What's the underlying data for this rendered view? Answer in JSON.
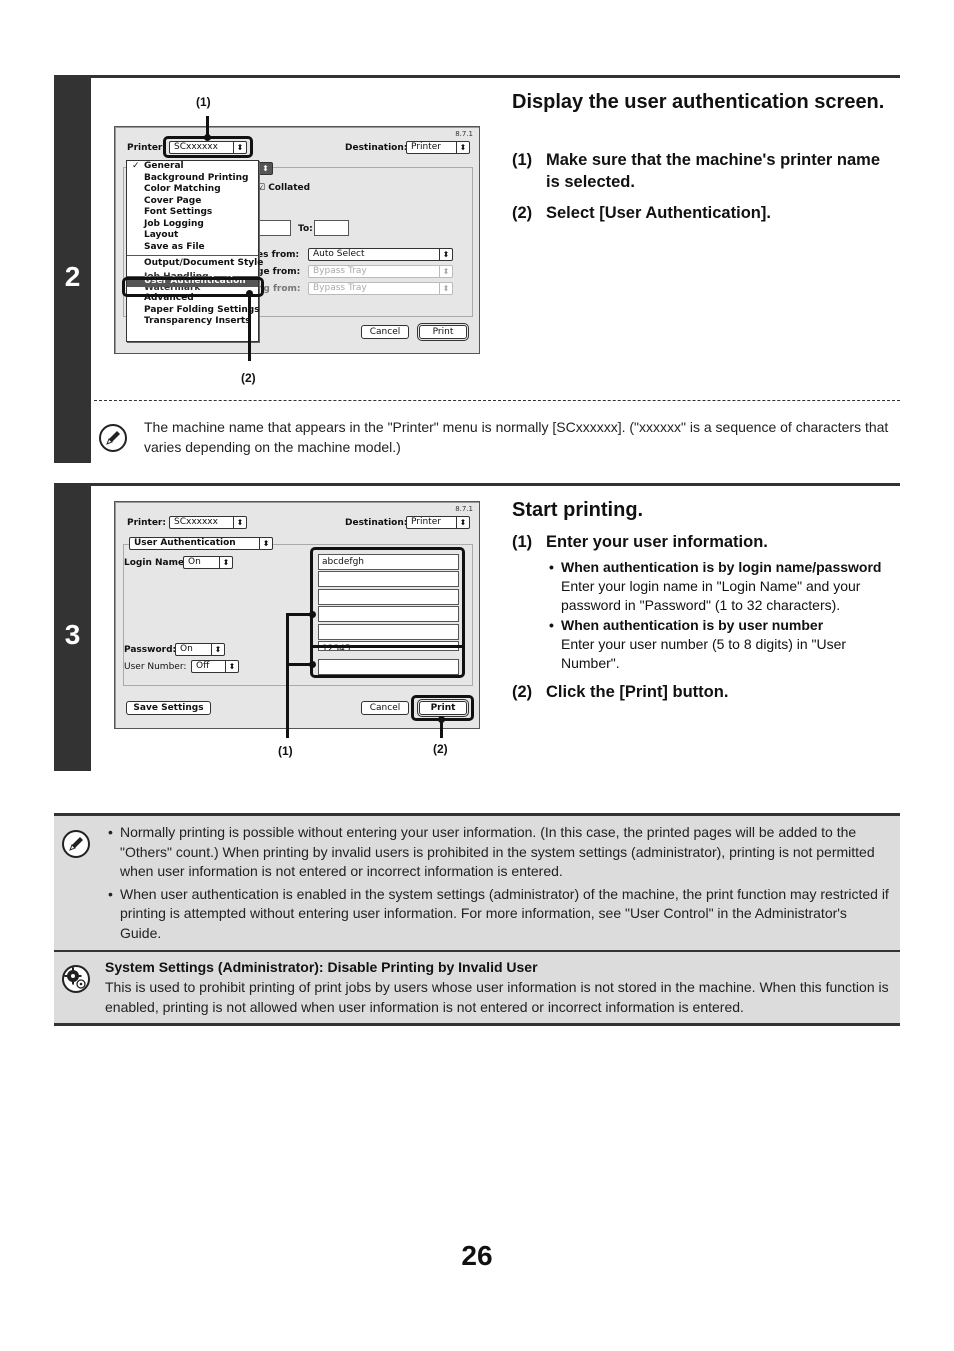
{
  "step2": {
    "number": "2",
    "heading": "Display the user authentication screen.",
    "items": [
      {
        "num": "(1)",
        "text": "Make sure that the machine's printer name is selected."
      },
      {
        "num": "(2)",
        "text": "Select [User Authentication]."
      }
    ],
    "dialog": {
      "version": "8.7.1",
      "printer_label": "Printer:",
      "printer_value": "SCxxxxxx",
      "destination_label": "Destination:",
      "destination_value": "Printer",
      "menu_items": [
        "General",
        "Background Printing",
        "Color Matching",
        "Cover Page",
        "Font Settings",
        "Job Logging",
        "Layout",
        "Save as File",
        "Output/Document Style",
        "Job Handling",
        "User Authentication",
        "Watermark",
        "Advanced",
        "Paper Folding Settings",
        "Transparency Inserts"
      ],
      "checked_item": "General",
      "selected_item": "User Authentication",
      "collated_label": "Collated",
      "to_label": "To:",
      "pages_from_label": "es from:",
      "pages_from_value": "Auto Select",
      "first_page_label": "ge from:",
      "first_page_value": "Bypass Tray",
      "remaining_label": "ng from:",
      "remaining_value": "Bypass Tray",
      "cancel_label": "Cancel",
      "print_label": "Print",
      "callout_1": "(1)",
      "callout_2": "(2)"
    },
    "note": "The machine name that appears in the \"Printer\" menu is normally [SCxxxxxx]. (\"xxxxxx\" is a sequence of characters that varies depending on the machine model.)"
  },
  "step3": {
    "number": "3",
    "heading": "Start printing.",
    "item1": {
      "num": "(1)",
      "text": "Enter your user information."
    },
    "bullets": [
      {
        "title": "When authentication is by login name/password",
        "text": "Enter your login name in \"Login Name\" and your password in \"Password\" (1 to 32 characters)."
      },
      {
        "title": "When authentication is by user number",
        "text": "Enter your user number (5 to 8 digits) in \"User Number\"."
      }
    ],
    "item2": {
      "num": "(2)",
      "text": "Click the [Print] button."
    },
    "dialog": {
      "version": "8.7.1",
      "printer_label": "Printer:",
      "printer_value": "SCxxxxxx",
      "destination_label": "Destination:",
      "destination_value": "Printer",
      "panel_value": "User Authentication",
      "login_name_label": "Login Name:",
      "login_name_value": "On",
      "password_label": "Password:",
      "password_value": "On",
      "user_number_label": "User Number:",
      "user_number_value": "Off",
      "fields": [
        "abcdefgh",
        "",
        "",
        "",
        "",
        "12345",
        ""
      ],
      "save_settings_label": "Save Settings",
      "cancel_label": "Cancel",
      "print_label": "Print",
      "callout_1": "(1)",
      "callout_2": "(2)"
    }
  },
  "notes": {
    "bullets": [
      "Normally printing is possible without entering your user information. (In this case, the printed pages will be added to the \"Others\" count.) When printing by invalid users is prohibited in the system settings (administrator), printing is not permitted when user information is not entered or incorrect information is entered.",
      "When user authentication is enabled in the system settings (administrator) of the machine, the print function may restricted if printing is attempted without entering user information. For more information, see \"User Control\" in the Administrator's Guide."
    ],
    "system_settings": {
      "title": "System Settings (Administrator): Disable Printing by Invalid User",
      "body": "This is used to prohibit printing of print jobs by users whose user information is not stored in the machine. When this function is enabled, printing is not allowed when user information is not entered or incorrect information is entered."
    }
  },
  "page_number": "26"
}
